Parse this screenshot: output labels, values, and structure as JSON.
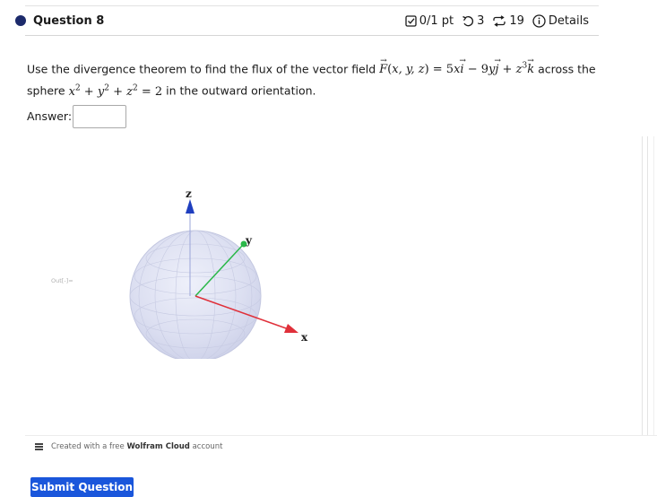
{
  "question": {
    "title": "Question 8",
    "score": "0/1 pt",
    "attempts": "3",
    "retries": "19",
    "details_label": "Details"
  },
  "prompt": {
    "part1": "Use the divergence theorem to find the flux of the vector field ",
    "part2": " across the sphere ",
    "part3": " in the outward orientation."
  },
  "answer": {
    "label": "Answer:",
    "value": ""
  },
  "plot": {
    "out_label": "Out[-]=",
    "axis_z": "z",
    "axis_y": "y",
    "axis_x": "x",
    "colors": {
      "sphere": "#d4d8f0",
      "x_axis": "#e0303a",
      "y_axis": "#2bb84a",
      "z_axis": "#1f3fbf"
    }
  },
  "wolfram": {
    "prefix": "Created with a free",
    "brand": "Wolfram Cloud",
    "suffix": "account"
  },
  "submit_label": "Submit Question",
  "colors": {
    "accent": "#1a56db",
    "bullet": "#1c2a6b"
  }
}
